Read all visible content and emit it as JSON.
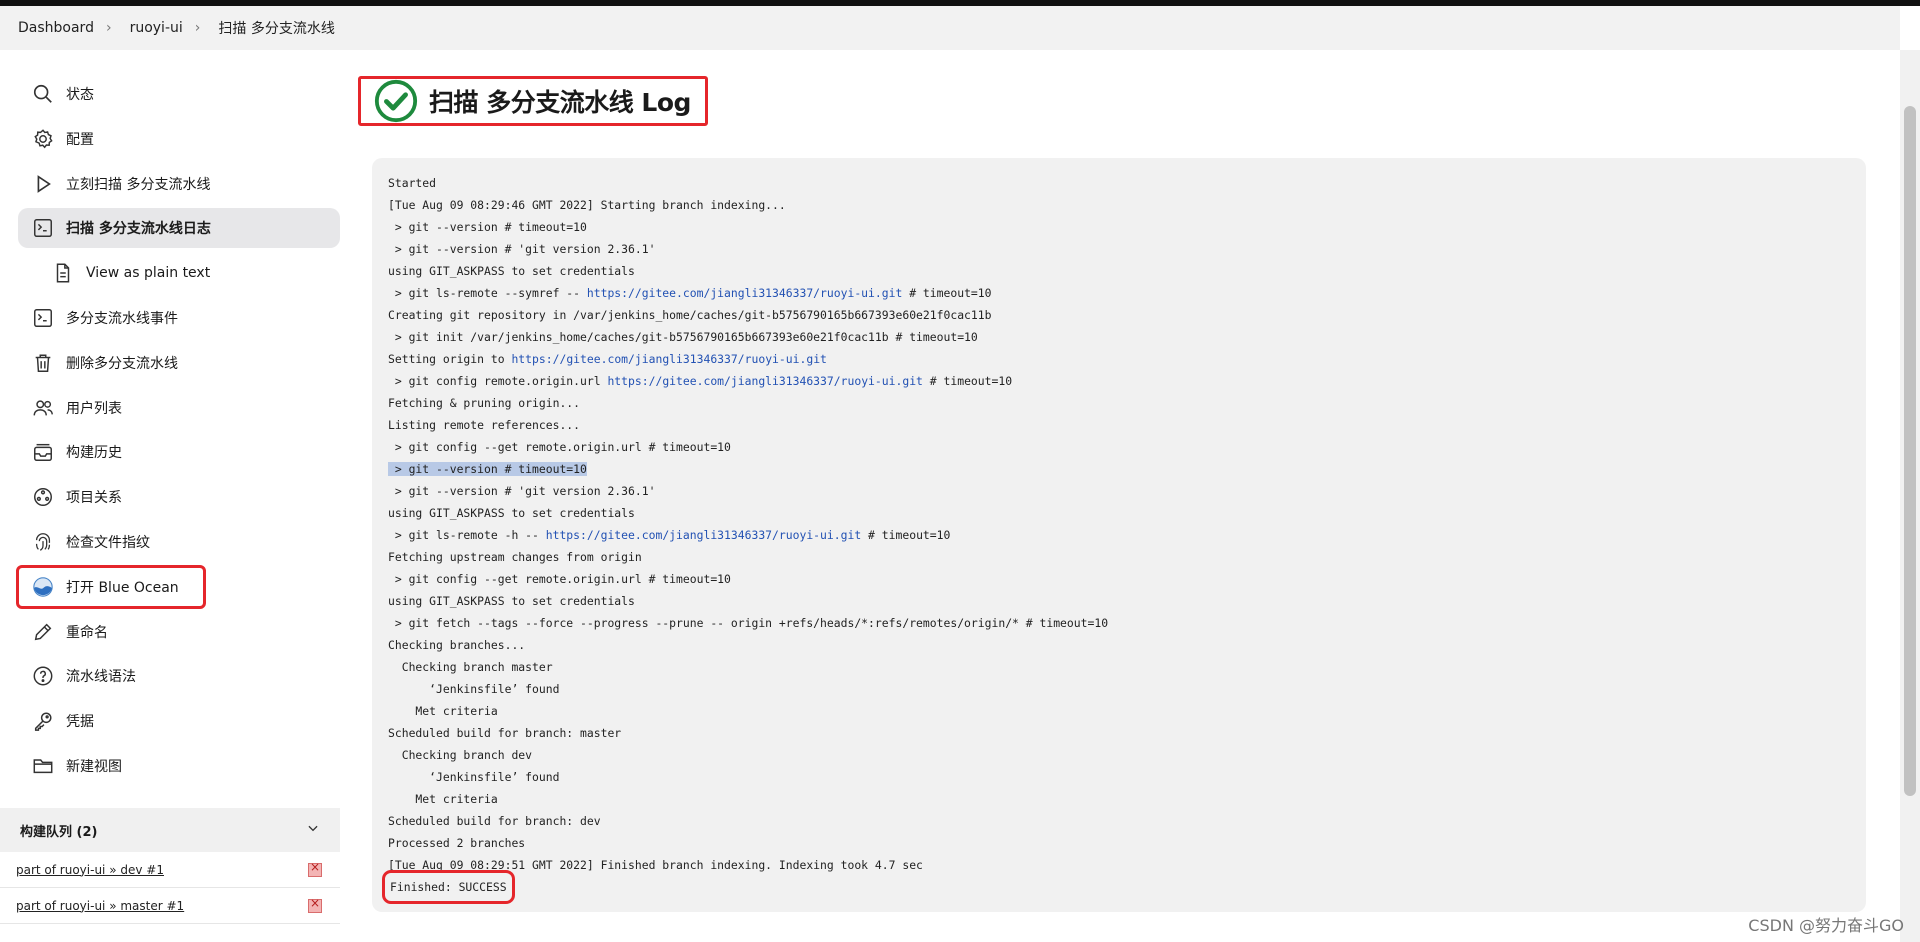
{
  "breadcrumb": [
    "Dashboard",
    "ruoyi-ui",
    "扫描 多分支流水线"
  ],
  "sidebar": {
    "items": [
      {
        "label": "状态",
        "icon": "search-icon"
      },
      {
        "label": "配置",
        "icon": "gear-icon"
      },
      {
        "label": "立刻扫描 多分支流水线",
        "icon": "play-icon"
      },
      {
        "label": "扫描 多分支流水线日志",
        "icon": "terminal-icon"
      },
      {
        "label": "View as plain text",
        "icon": "document-icon"
      },
      {
        "label": "多分支流水线事件",
        "icon": "terminal-icon"
      },
      {
        "label": "删除多分支流水线",
        "icon": "trash-icon"
      },
      {
        "label": "用户列表",
        "icon": "people-icon"
      },
      {
        "label": "构建历史",
        "icon": "history-icon"
      },
      {
        "label": "项目关系",
        "icon": "relations-icon"
      },
      {
        "label": "检查文件指纹",
        "icon": "fingerprint-icon"
      },
      {
        "label": "打开 Blue Ocean",
        "icon": "blue-ocean-icon"
      },
      {
        "label": "重命名",
        "icon": "pencil-icon"
      },
      {
        "label": "流水线语法",
        "icon": "help-icon"
      },
      {
        "label": "凭据",
        "icon": "key-icon"
      },
      {
        "label": "新建视图",
        "icon": "folder-icon"
      }
    ],
    "active_index": 3
  },
  "queue": {
    "title": "构建队列 (2)",
    "items": [
      "part of ruoyi-ui » dev #1",
      "part of ruoyi-ui » master #1"
    ]
  },
  "page": {
    "title": "扫描 多分支流水线 Log",
    "status_icon": "success-check-icon"
  },
  "console": {
    "lines": [
      "Started",
      "[Tue Aug 09 08:29:46 GMT 2022] Starting branch indexing...",
      " > git --version # timeout=10",
      " > git --version # 'git version 2.36.1'",
      "using GIT_ASKPASS to set credentials",
      " > git ls-remote --symref -- https://gitee.com/jiangli31346337/ruoyi-ui.git # timeout=10",
      "Creating git repository in /var/jenkins_home/caches/git-b5756790165b667393e60e21f0cac11b",
      " > git init /var/jenkins_home/caches/git-b5756790165b667393e60e21f0cac11b # timeout=10",
      "Setting origin to https://gitee.com/jiangli31346337/ruoyi-ui.git",
      " > git config remote.origin.url https://gitee.com/jiangli31346337/ruoyi-ui.git # timeout=10",
      "Fetching & pruning origin...",
      "Listing remote references...",
      " > git config --get remote.origin.url # timeout=10",
      " > git --version # timeout=10",
      " > git --version # 'git version 2.36.1'",
      "using GIT_ASKPASS to set credentials",
      " > git ls-remote -h -- https://gitee.com/jiangli31346337/ruoyi-ui.git # timeout=10",
      "Fetching upstream changes from origin",
      " > git config --get remote.origin.url # timeout=10",
      "using GIT_ASKPASS to set credentials",
      " > git fetch --tags --force --progress --prune -- origin +refs/heads/*:refs/remotes/origin/* # timeout=10",
      "Checking branches...",
      "  Checking branch master",
      "      ‘Jenkinsfile’ found",
      "    Met criteria",
      "Scheduled build for branch: master",
      "  Checking branch dev",
      "      ‘Jenkinsfile’ found",
      "    Met criteria",
      "Scheduled build for branch: dev",
      "Processed 2 branches",
      "[Tue Aug 09 08:29:51 GMT 2022] Finished branch indexing. Indexing took 4.7 sec",
      "Finished: SUCCESS"
    ],
    "link": "https://gitee.com/jiangli31346337/ruoyi-ui.git"
  },
  "watermark": "CSDN @努力奋斗GO"
}
